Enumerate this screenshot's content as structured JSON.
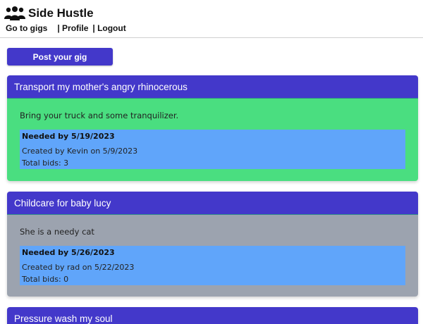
{
  "app": {
    "title": "Side Hustle",
    "brand_icon": "users-icon"
  },
  "nav": {
    "items": [
      {
        "label": "Go to gigs"
      },
      {
        "label": "| Profile"
      },
      {
        "label": "| Logout"
      }
    ]
  },
  "actions": {
    "post_gig_label": "Post your gig"
  },
  "colors": {
    "primary": "#4338ca",
    "card_open": "#4ade80",
    "card_closed": "#9ca3af",
    "meta_panel": "#60a5fa"
  },
  "gigs": [
    {
      "title": "Transport my mother's angry rhinocerous",
      "description": "Bring your truck and some tranquilizer.",
      "needed_by": "Needed by 5/19/2023",
      "created": "Created by Kevin on 5/9/2023",
      "bids": "Total bids: 3"
    },
    {
      "title": "Childcare for baby lucy",
      "description": "She is a needy cat",
      "needed_by": "Needed by 5/26/2023",
      "created": "Created by rad on 5/22/2023",
      "bids": "Total bids: 0"
    },
    {
      "title": "Pressure wash my soul"
    }
  ]
}
